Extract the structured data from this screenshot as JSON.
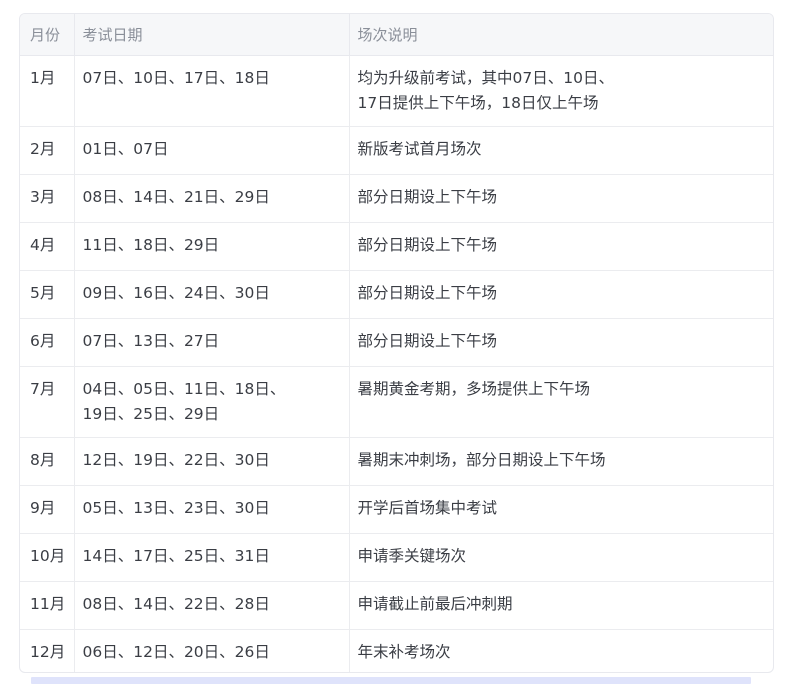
{
  "table": {
    "headers": [
      "月份",
      "考试日期",
      "场次说明"
    ],
    "rows": [
      {
        "month": "1月",
        "dates": [
          "07日、10日、17日、18日"
        ],
        "note": [
          "均为升级前考试，其中07日、10日、",
          "17日提供上下午场，18日仅上午场"
        ]
      },
      {
        "month": "2月",
        "dates": [
          "01日、07日"
        ],
        "note": [
          "新版考试首月场次"
        ]
      },
      {
        "month": "3月",
        "dates": [
          "08日、14日、21日、29日"
        ],
        "note": [
          "部分日期设上下午场"
        ]
      },
      {
        "month": "4月",
        "dates": [
          "11日、18日、29日"
        ],
        "note": [
          "部分日期设上下午场"
        ]
      },
      {
        "month": "5月",
        "dates": [
          "09日、16日、24日、30日"
        ],
        "note": [
          "部分日期设上下午场"
        ]
      },
      {
        "month": "6月",
        "dates": [
          "07日、13日、27日"
        ],
        "note": [
          "部分日期设上下午场"
        ]
      },
      {
        "month": "7月",
        "dates": [
          "04日、05日、11日、18日、",
          "19日、25日、29日"
        ],
        "note": [
          "暑期黄金考期，多场提供上下午场"
        ]
      },
      {
        "month": "8月",
        "dates": [
          "12日、19日、22日、30日"
        ],
        "note": [
          "暑期末冲刺场，部分日期设上下午场"
        ]
      },
      {
        "month": "9月",
        "dates": [
          "05日、13日、23日、30日"
        ],
        "note": [
          "开学后首场集中考试"
        ]
      },
      {
        "month": "10月",
        "dates": [
          "14日、17日、25日、31日"
        ],
        "note": [
          "申请季关键场次"
        ]
      },
      {
        "month": "11月",
        "dates": [
          "08日、14日、22日、28日"
        ],
        "note": [
          "申请截止前最后冲刺期"
        ]
      },
      {
        "month": "12月",
        "dates": [
          "06日、12日、20日、26日"
        ],
        "note": [
          "年末补考场次"
        ]
      }
    ]
  }
}
